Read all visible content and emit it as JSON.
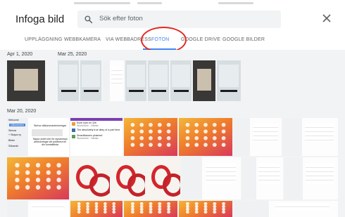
{
  "dialog": {
    "title": "Infoga bild",
    "search_placeholder": "Sök efter foton",
    "close_icon": "close-icon",
    "search_icon": "search-icon"
  },
  "tabs": [
    {
      "label": "UPPLÄGGNING",
      "active": false
    },
    {
      "label": "WEBBKAMERA",
      "active": false
    },
    {
      "label": "VIA WEBBADRESS",
      "active": false
    },
    {
      "label": "FOTON",
      "active": true
    },
    {
      "label": "GOOGLE DRIVE",
      "active": false
    },
    {
      "label": "GOOGLE BILDER",
      "active": false
    }
  ],
  "colors": {
    "accent": "#4285f4",
    "annotation_circle": "#e5261f",
    "grid_background": "#f1f3f4"
  },
  "groups": [
    {
      "date": "Apr 1, 2020"
    },
    {
      "date": "Mar 25, 2020"
    },
    {
      "date": "Mar 20, 2020"
    }
  ],
  "thumb_text": {
    "note_shot": {
      "top_title": "Welcome",
      "top_button": "Välkommen",
      "list": [
        "Välkommen",
        "Skrivar",
        "+ Skapa ny",
        "Bilder",
        "Sökande"
      ],
      "item1": "Skriva välkommanteckningar",
      "empty_text": "Tappa ordet inte för dynamiska anteckningar att publicera till din kontaktlista"
    },
    "news_shot": {
      "item1_title": "Eunk hyrs en 32b",
      "item1_sub": "Stockholm · Hämta",
      "item2_title": "The absolutely true diary of a part time",
      "item3_title": "Smartklassen plusmed",
      "item3_sub": "Stockholm · Hämta"
    }
  }
}
